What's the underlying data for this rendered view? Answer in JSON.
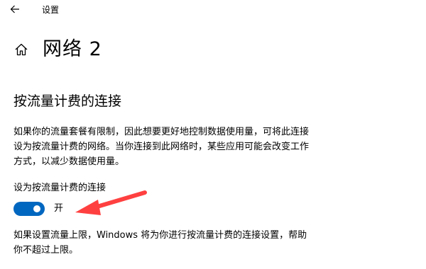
{
  "window": {
    "back_icon": "arrow-left-icon",
    "app_title": "设置"
  },
  "header": {
    "home_icon": "home-icon",
    "title": "网络 2"
  },
  "metered": {
    "section_title": "按流量计费的连接",
    "description": "如果你的流量套餐有限制，因此想要更好地控制数据使用量，可将此连接\n设为按流量计费的网络。当你连接到此网络时，某些应用可能会改变工作\n方式，以减少数据使用量。",
    "toggle_label": "设为按流量计费的连接",
    "toggle_state_label": "开",
    "toggle_on": true,
    "footer_note": "如果设置流量上限，Windows 将为你进行按流量计费的连接设置，帮助\n你不超过上限。"
  },
  "colors": {
    "accent": "#0067c0",
    "annotation_arrow": "#ff4040"
  }
}
